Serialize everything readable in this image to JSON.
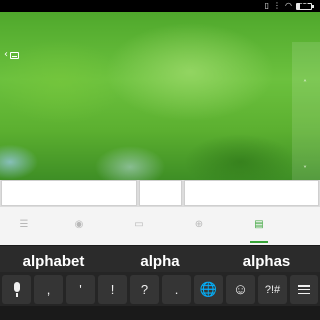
{
  "status_bar": {
    "icons": [
      "sim-icon",
      "vibrate-icon",
      "wifi-icon",
      "battery-icon"
    ],
    "glyphs": {
      "sim": "▯",
      "vibrate": "⋮",
      "wifi": "◠"
    },
    "battery_level": "23",
    "battery_fraction": 0.23
  },
  "screen": {
    "back_icon": "chevron-left-icon",
    "keyboard_toggle_icon": "keyboard-icon",
    "back_chevron": "‹",
    "scroll_up": "˄",
    "scroll_down": "˅"
  },
  "input_fields": [
    {
      "value": ""
    },
    {
      "value": ""
    },
    {
      "value": ""
    }
  ],
  "toolstrip": {
    "items": [
      {
        "icon": "list-icon",
        "glyph": "☰"
      },
      {
        "icon": "record-icon",
        "glyph": "◉"
      },
      {
        "icon": "card-icon",
        "glyph": "▭"
      },
      {
        "icon": "globe-icon",
        "glyph": "⊕"
      },
      {
        "icon": "keyboard-icon",
        "glyph": "▤"
      }
    ],
    "active_color": "#3aa53a",
    "inactive_color": "#b8b8b8"
  },
  "suggestions": [
    "alphabet",
    "alpha",
    "alphas"
  ],
  "keys": {
    "comma": ",",
    "apostrophe": "'",
    "exclaim": "!",
    "question": "?",
    "period": ".",
    "globe": "🌐",
    "emoji": "☺",
    "symbols": "?!#"
  },
  "colors": {
    "suggestion_bg": "#2b2b2b",
    "key_bg": "#353535",
    "accent": "#3aa53a"
  }
}
